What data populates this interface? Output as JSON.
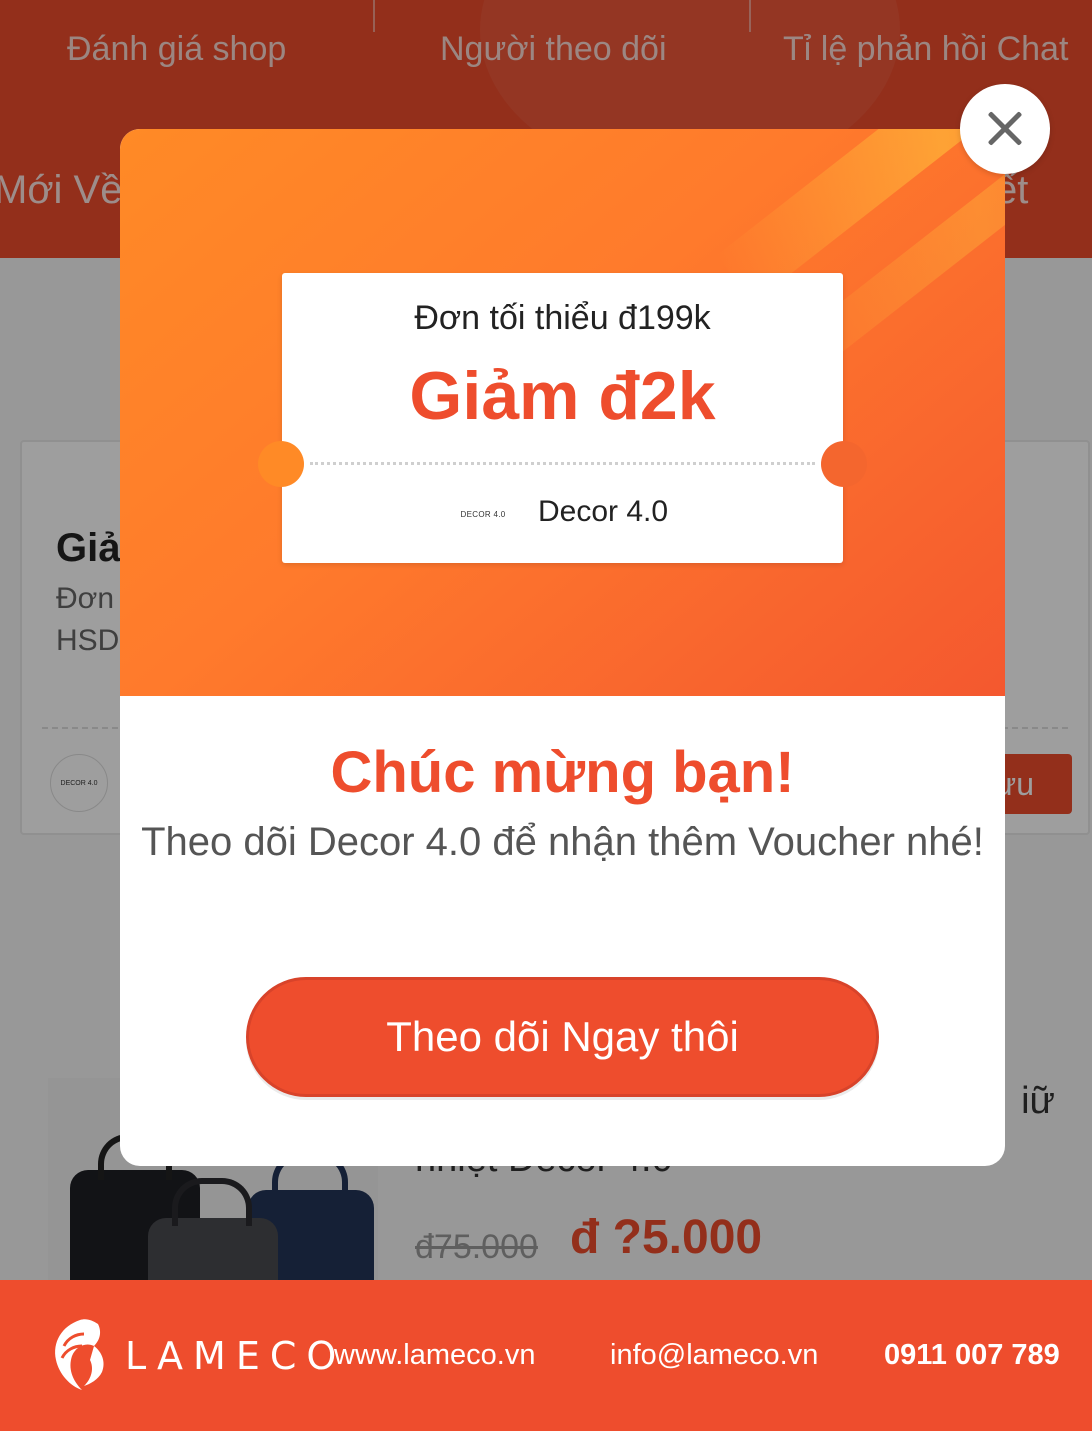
{
  "shop_header": {
    "stats": [
      "Đánh giá shop",
      "Người theo dõi",
      "Tỉ lệ phản hồi Chat"
    ],
    "tabs": [
      "Mới Về",
      "ết"
    ]
  },
  "voucher_card": {
    "title": "Giả",
    "min_order": "Đơn",
    "expiry": "HSD",
    "save_button": "ưu"
  },
  "product": {
    "title": "iữ",
    "subtitle": "nhiệt Decor 4.0",
    "price_old": "đ75.000",
    "price_new": "đ ?5.000"
  },
  "modal": {
    "coupon": {
      "min_order": "Đơn tối thiểu đ199k",
      "discount": "Giảm đ2k",
      "shop_name": "Decor 4.0",
      "shop_logo_text": "DECOR 4.0"
    },
    "congrats": "Chúc mừng bạn!",
    "description": "Theo dõi Decor 4.0 để nhận thêm Voucher nhé!",
    "follow_button": "Theo dõi Ngay thôi"
  },
  "footer": {
    "brand": "LAMECO",
    "website": "www.lameco.vn",
    "email": "info@lameco.vn",
    "phone": "0911 007 789"
  },
  "colors": {
    "accent": "#ee4d2d",
    "gradient_start": "#ff8a26",
    "gradient_end": "#f4582f"
  }
}
